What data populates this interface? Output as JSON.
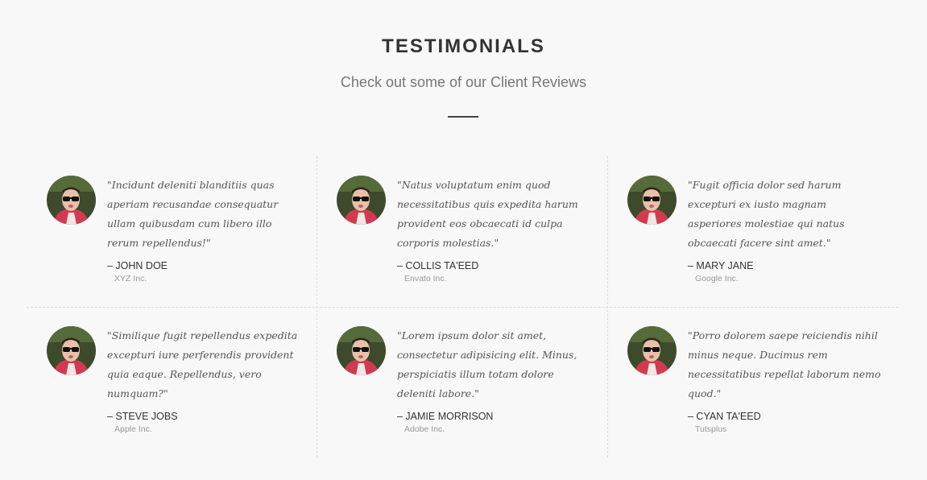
{
  "section": {
    "title": "TESTIMONIALS",
    "subtitle": "Check out some of our Client Reviews"
  },
  "testimonials": [
    {
      "quote": "\"Incidunt deleniti blanditiis quas aperiam recusandae consequatur ullam quibusdam cum libero illo rerum repellendus!\"",
      "author": "– JOHN DOE",
      "company": "XYZ Inc."
    },
    {
      "quote": "\"Natus voluptatum enim quod necessitatibus quis expedita harum provident eos obcaecati id culpa corporis molestias.\"",
      "author": "– COLLIS TA'EED",
      "company": "Envato Inc."
    },
    {
      "quote": "\"Fugit officia dolor sed harum excepturi ex iusto magnam asperiores molestiae qui natus obcaecati facere sint amet.\"",
      "author": "– MARY JANE",
      "company": "Google Inc."
    },
    {
      "quote": "\"Similique fugit repellendus expedita excepturi iure perferendis provident quia eaque. Repellendus, vero numquam?\"",
      "author": "– STEVE JOBS",
      "company": "Apple Inc."
    },
    {
      "quote": "\"Lorem ipsum dolor sit amet, consectetur adipisicing elit. Minus, perspiciatis illum totam dolore deleniti labore.\"",
      "author": "– JAMIE MORRISON",
      "company": "Adobe Inc."
    },
    {
      "quote": "\"Porro dolorem saepe reiciendis nihil minus neque. Ducimus rem necessitatibus repellat laborum nemo quod.\"",
      "author": "– CYAN TA'EED",
      "company": "Tutsplus"
    }
  ]
}
